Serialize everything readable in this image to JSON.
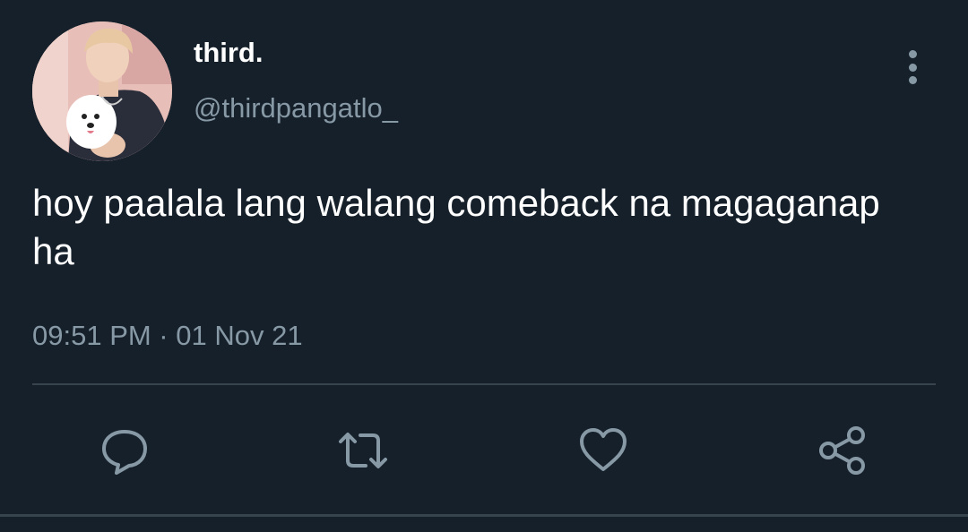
{
  "user": {
    "display_name": "third.",
    "handle": "@thirdpangatlo_"
  },
  "tweet": {
    "text": "hoy paalala lang walang comeback na magaganap ha",
    "timestamp": "09:51 PM · 01 Nov 21"
  },
  "actions": {
    "reply_icon": "speech-bubble",
    "retweet_icon": "retweet-arrows",
    "like_icon": "heart-outline",
    "share_icon": "share-nodes"
  },
  "colors": {
    "background": "#15202b",
    "primary_text": "#ffffff",
    "secondary_text": "#8899a6",
    "divider": "#38444d"
  }
}
